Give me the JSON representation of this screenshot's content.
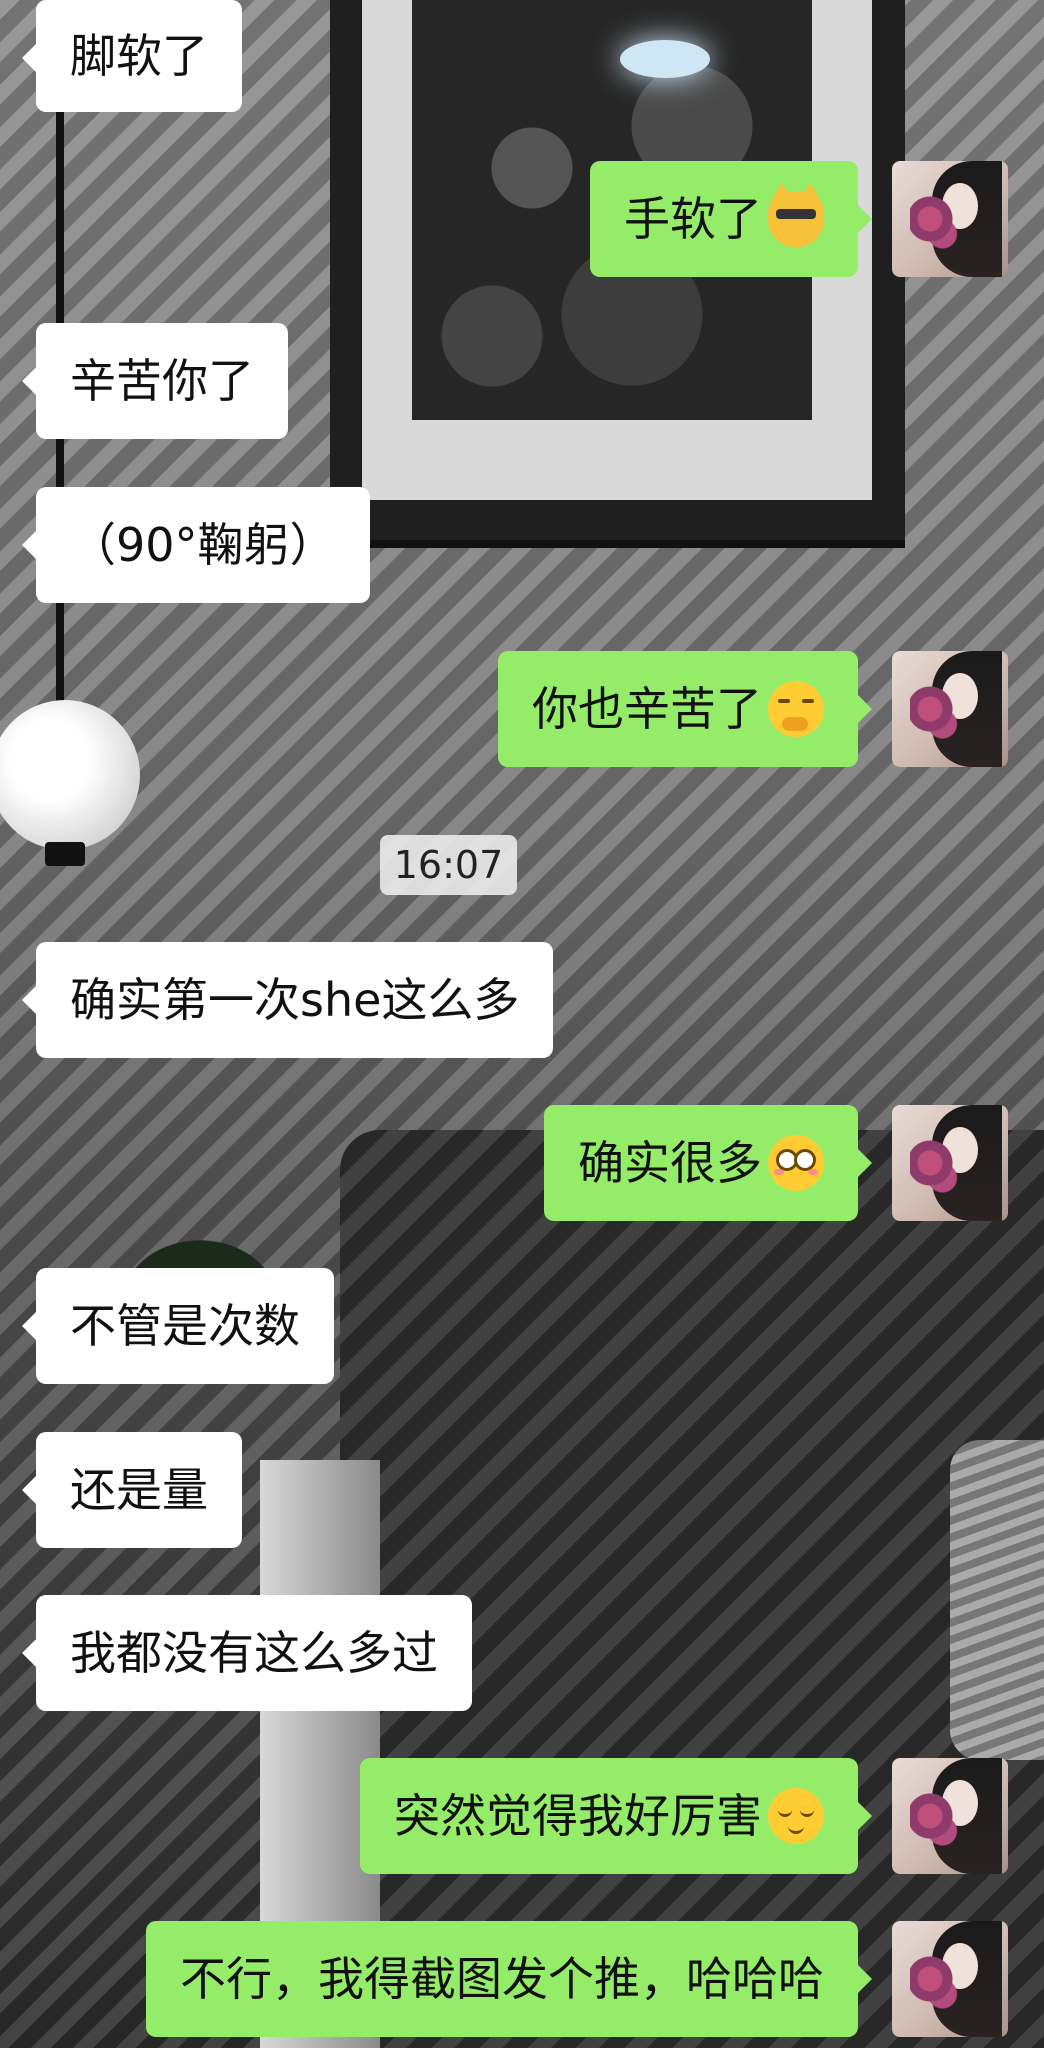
{
  "theme": {
    "incoming_bubble_color": "#ffffff",
    "outgoing_bubble_color": "#95ec69",
    "text_color": "#111111"
  },
  "messages": [
    {
      "side": "left",
      "text": "脚软了"
    },
    {
      "side": "right",
      "text": "手软了",
      "emoji": "cat-sunglasses-emoji"
    },
    {
      "side": "left",
      "text": "辛苦你了"
    },
    {
      "side": "left",
      "text": "（90°鞠躬）"
    },
    {
      "side": "right",
      "text": "你也辛苦了",
      "emoji": "thinking-face-emoji"
    },
    {
      "side": "left",
      "text": "确实第一次she这么多"
    },
    {
      "side": "right",
      "text": "确实很多",
      "emoji": "flushed-face-emoji"
    },
    {
      "side": "left",
      "text": "不管是次数"
    },
    {
      "side": "left",
      "text": "还是量"
    },
    {
      "side": "left",
      "text": "我都没有这么多过"
    },
    {
      "side": "right",
      "text": "突然觉得我好厉害",
      "emoji": "smug-face-emoji"
    },
    {
      "side": "right",
      "text": "不行，我得截图发个推，哈哈哈"
    }
  ],
  "timestamp": "16:07",
  "avatar": {
    "icon": "user-avatar"
  }
}
